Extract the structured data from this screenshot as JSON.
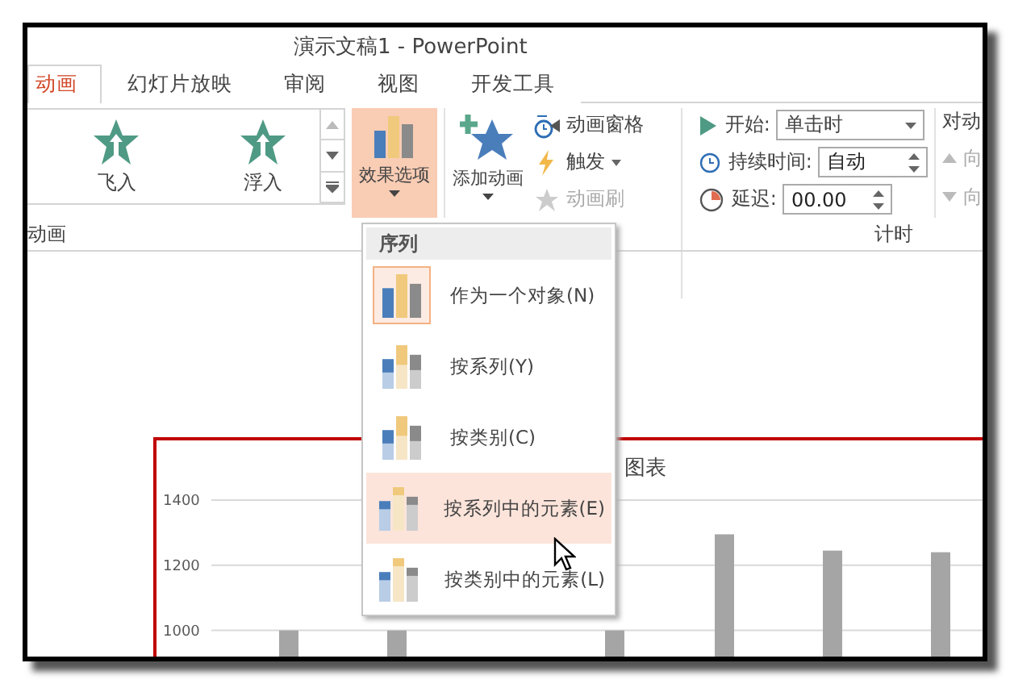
{
  "window": {
    "title": "演示文稿1 - PowerPoint"
  },
  "tabs": [
    {
      "label": "动画",
      "selected": true
    },
    {
      "label": "幻灯片放映",
      "selected": false
    },
    {
      "label": "审阅",
      "selected": false
    },
    {
      "label": "视图",
      "selected": false
    },
    {
      "label": "开发工具",
      "selected": false
    }
  ],
  "ribbon": {
    "gallery": [
      {
        "label": "飞入"
      },
      {
        "label": "浮入"
      }
    ],
    "effect_options": {
      "label": "效果选项",
      "pressed": true
    },
    "add_animation": {
      "label": "添加动画"
    },
    "advanced": [
      {
        "kind": "pane",
        "label": "动画窗格",
        "disabled": false
      },
      {
        "kind": "trigger",
        "label": "触发",
        "disabled": false
      },
      {
        "kind": "painter",
        "label": "动画刷",
        "disabled": true
      }
    ],
    "timing": {
      "start_label": "开始:",
      "start_value": "单击时",
      "duration_label": "持续时间:",
      "duration_value": "自动",
      "delay_label": "延迟:",
      "delay_value": "00.00"
    },
    "reorder": {
      "title": "对动",
      "items": [
        {
          "label": "向"
        },
        {
          "label": "向"
        }
      ]
    },
    "group_labels": {
      "animation": "动画",
      "timing": "计时"
    }
  },
  "menu": {
    "header": "序列",
    "items": [
      {
        "label": "作为一个对象(N)",
        "kind": "one",
        "selected": true,
        "highlighted": false
      },
      {
        "label": "按系列(Y)",
        "kind": "series",
        "selected": false,
        "highlighted": false
      },
      {
        "label": "按类别(C)",
        "kind": "category",
        "selected": false,
        "highlighted": false
      },
      {
        "label": "按系列中的元素(E)",
        "kind": "series_elements",
        "selected": false,
        "highlighted": true
      },
      {
        "label": "按类别中的元素(L)",
        "kind": "category_elements",
        "selected": false,
        "highlighted": false
      }
    ]
  },
  "slide": {
    "chart_title": "图表",
    "chart_data": {
      "type": "bar",
      "ylim": [
        900,
        1400
      ],
      "grid": true,
      "yticks": [
        1000,
        1200,
        1400
      ],
      "values": [
        1000,
        1000,
        null,
        1000,
        1295,
        1245,
        1240
      ]
    }
  }
}
